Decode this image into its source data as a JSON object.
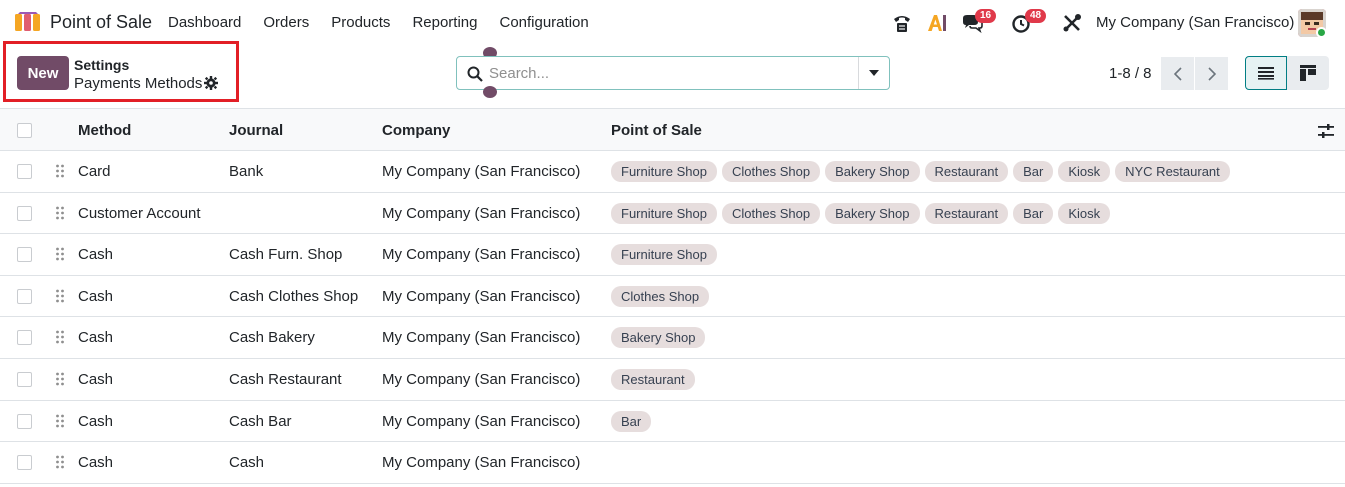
{
  "navbar": {
    "app_name": "Point of Sale",
    "menu": [
      "Dashboard",
      "Orders",
      "Products",
      "Reporting",
      "Configuration"
    ],
    "messages_count": "16",
    "activities_count": "48",
    "company": "My Company (San Francisco)",
    "icons": [
      "phone-icon",
      "ai-icon",
      "chat-icon",
      "clock-icon",
      "tools-icon"
    ]
  },
  "control_panel": {
    "new_label": "New",
    "breadcrumb_parent": "Settings",
    "breadcrumb_current": "Payments Methods",
    "search_placeholder": "Search...",
    "pager_value": "1-8 / 8"
  },
  "table": {
    "columns": [
      "Method",
      "Journal",
      "Company",
      "Point of Sale"
    ],
    "rows": [
      {
        "method": "Card",
        "journal": "Bank",
        "company": "My Company (San Francisco)",
        "pos": [
          "Furniture Shop",
          "Clothes Shop",
          "Bakery Shop",
          "Restaurant",
          "Bar",
          "Kiosk",
          "NYC Restaurant"
        ]
      },
      {
        "method": "Customer Account",
        "journal": "",
        "company": "My Company (San Francisco)",
        "pos": [
          "Furniture Shop",
          "Clothes Shop",
          "Bakery Shop",
          "Restaurant",
          "Bar",
          "Kiosk"
        ]
      },
      {
        "method": "Cash",
        "journal": "Cash Furn. Shop",
        "company": "My Company (San Francisco)",
        "pos": [
          "Furniture Shop"
        ]
      },
      {
        "method": "Cash",
        "journal": "Cash Clothes Shop",
        "company": "My Company (San Francisco)",
        "pos": [
          "Clothes Shop"
        ]
      },
      {
        "method": "Cash",
        "journal": "Cash Bakery",
        "company": "My Company (San Francisco)",
        "pos": [
          "Bakery Shop"
        ]
      },
      {
        "method": "Cash",
        "journal": "Cash Restaurant",
        "company": "My Company (San Francisco)",
        "pos": [
          "Restaurant"
        ]
      },
      {
        "method": "Cash",
        "journal": "Cash Bar",
        "company": "My Company (San Francisco)",
        "pos": [
          "Bar"
        ]
      },
      {
        "method": "Cash",
        "journal": "Cash",
        "company": "My Company (San Francisco)",
        "pos": []
      }
    ]
  },
  "colors": {
    "brand": "#714b67",
    "accent": "#017e84",
    "badge": "#e0394a",
    "highlight": "#e21f26",
    "tag_bg": "#e6dddd"
  }
}
